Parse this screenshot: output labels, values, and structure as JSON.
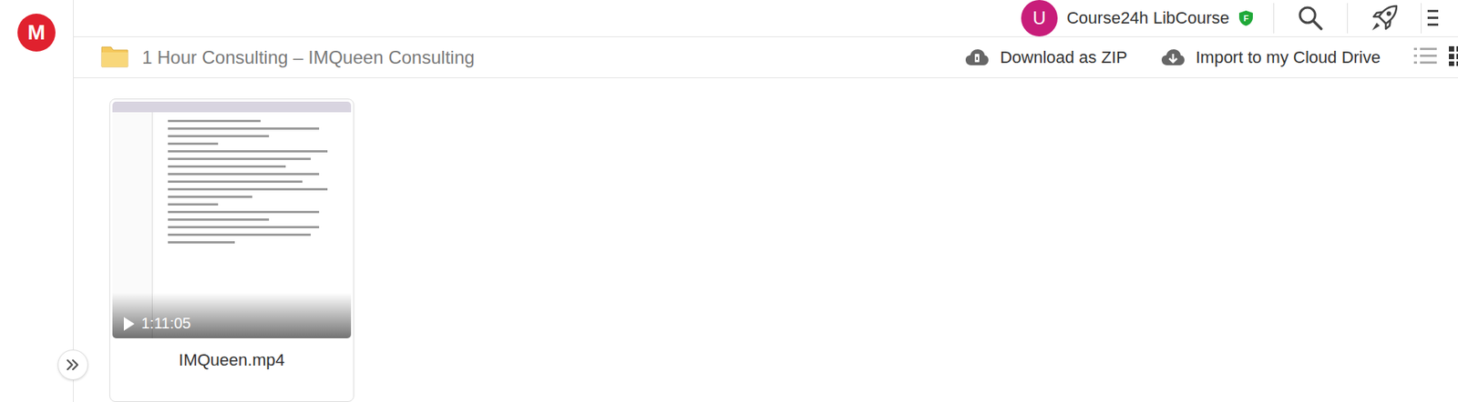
{
  "app": {
    "logo": "M"
  },
  "user": {
    "avatar": "U",
    "name": "Course24h LibCourse",
    "badge": "F"
  },
  "folder": {
    "title": "1 Hour Consulting – IMQueen Consulting",
    "actions": [
      {
        "label": "Download as ZIP"
      },
      {
        "label": "Import to my Cloud Drive"
      }
    ],
    "views": [
      {
        "name": "list",
        "selected": false
      },
      {
        "name": "grid",
        "selected": true
      }
    ]
  },
  "files": [
    {
      "name": "IMQueen.mp4",
      "kind": "video",
      "duration": "1:11:05"
    }
  ]
}
